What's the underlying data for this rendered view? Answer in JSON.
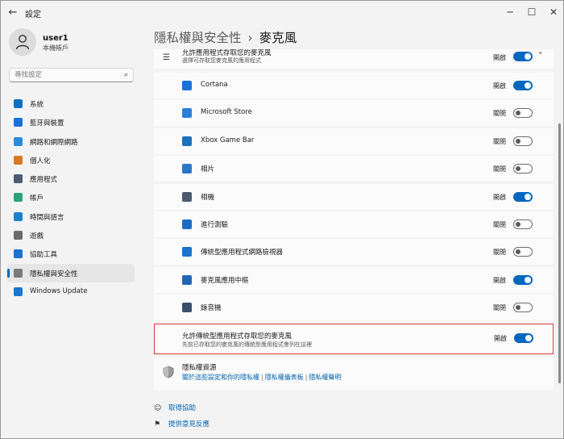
{
  "window": {
    "title": "設定",
    "back": "←",
    "minimize": "─",
    "maximize": "☐",
    "close": "✕"
  },
  "user": {
    "name": "user1",
    "subtitle": "本機帳戶"
  },
  "search": {
    "placeholder": "尋找設定",
    "icon": "⌕"
  },
  "nav": {
    "items": [
      {
        "label": "系統",
        "icon": "monitor-icon",
        "color": "#0a6fc2"
      },
      {
        "label": "藍牙與裝置",
        "icon": "bluetooth-icon",
        "color": "#1a6fd8"
      },
      {
        "label": "網路和網際網路",
        "icon": "wifi-icon",
        "color": "#2b8ad9"
      },
      {
        "label": "個人化",
        "icon": "brush-icon",
        "color": "#d77a24"
      },
      {
        "label": "應用程式",
        "icon": "apps-icon",
        "color": "#4b5b73"
      },
      {
        "label": "帳戶",
        "icon": "person-icon",
        "color": "#2aa37a"
      },
      {
        "label": "時間與語言",
        "icon": "globe-clock-icon",
        "color": "#1b82c9"
      },
      {
        "label": "遊戲",
        "icon": "gamepad-icon",
        "color": "#6b6b6b"
      },
      {
        "label": "協助工具",
        "icon": "accessibility-icon",
        "color": "#1d6fd1"
      },
      {
        "label": "隱私權與安全性",
        "icon": "shield-icon",
        "color": "#7a7a7a",
        "selected": true
      },
      {
        "label": "Windows Update",
        "icon": "update-icon",
        "color": "#1b78d0"
      }
    ]
  },
  "header": {
    "parent": "隱私權與安全性",
    "separator": "›",
    "current": "麥克風"
  },
  "apps_section": {
    "title": "允許應用程式存取您的麥克風",
    "subtitle": "選擇可存取您麥克風的應用程式",
    "state": "開啟",
    "on": true,
    "chevron": "⌃"
  },
  "apps": [
    {
      "label": "Cortana",
      "state": "開啟",
      "on": true,
      "color": "#1a73d9"
    },
    {
      "label": "Microsoft Store",
      "state": "關閉",
      "on": false,
      "color": "#2b7fd9"
    },
    {
      "label": "Xbox Game Bar",
      "state": "關閉",
      "on": false,
      "color": "#1f6fbf"
    },
    {
      "label": "相片",
      "state": "關閉",
      "on": false,
      "color": "#2a78c8"
    },
    {
      "label": "相機",
      "state": "開啟",
      "on": true,
      "color": "#4a5a70"
    },
    {
      "label": "進行測驗",
      "state": "關閉",
      "on": false,
      "color": "#1b6bc4"
    },
    {
      "label": "傳統型應用程式網路檢視器",
      "state": "關閉",
      "on": false,
      "color": "#1d72c9"
    },
    {
      "label": "麥克風應用中樞",
      "state": "開啟",
      "on": true,
      "color": "#2266b8"
    },
    {
      "label": "錄音機",
      "state": "關閉",
      "on": false,
      "color": "#3a4e6a"
    }
  ],
  "desktop_apps": {
    "title": "允許傳統型應用程式存取您的麥克風",
    "subtitle": "先前已存取您的麥克風的傳統型應用程式會列在這裡",
    "state": "開啟",
    "on": true
  },
  "resources": {
    "title": "隱私權資源",
    "links": [
      "關於這些設定和你的隱私權",
      "隱私權儀表板",
      "隱私權聲明"
    ],
    "separator": "|"
  },
  "footer": {
    "help": "取得協助",
    "feedback": "提供意見反應"
  }
}
